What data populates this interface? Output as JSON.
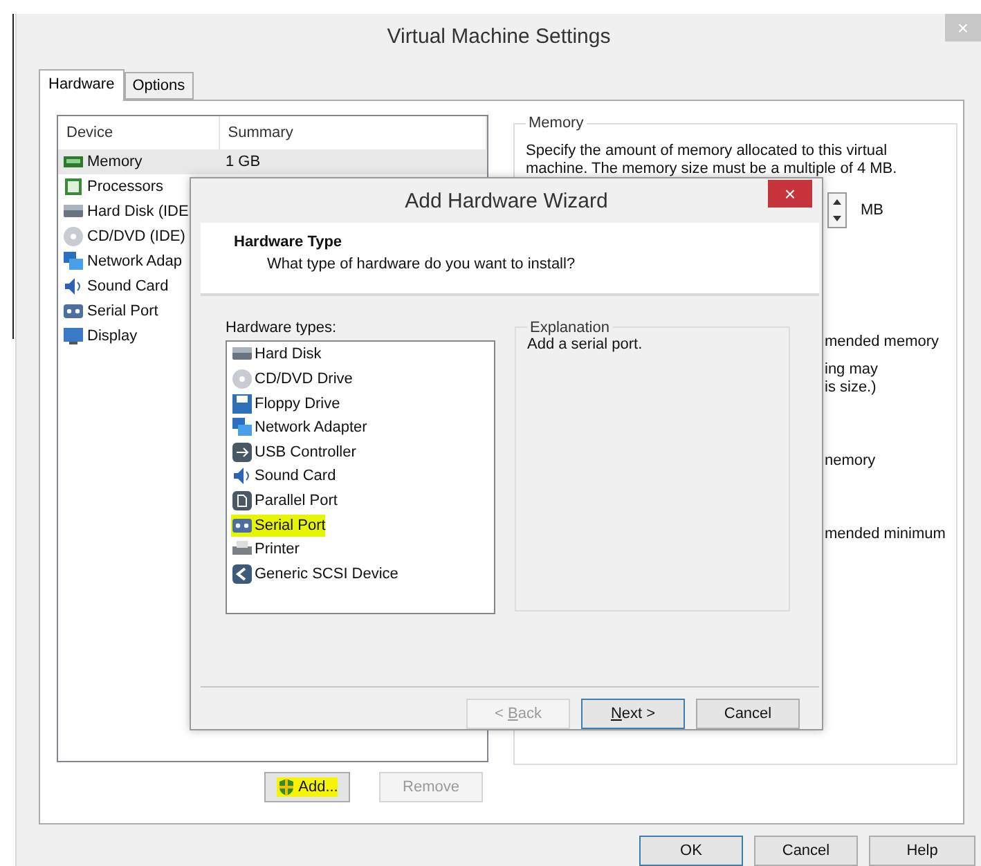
{
  "window": {
    "title": "Virtual Machine Settings",
    "close": "×"
  },
  "tabs": [
    {
      "label": "Hardware",
      "selected": true
    },
    {
      "label": "Options",
      "selected": false
    }
  ],
  "device_table": {
    "columns": [
      "Device",
      "Summary"
    ],
    "rows": [
      {
        "kind": "memory",
        "device": "Memory",
        "summary": "1 GB",
        "selected": true
      },
      {
        "kind": "processor",
        "device": "Processors",
        "selected": false
      },
      {
        "kind": "disk",
        "device": "Hard Disk (IDE",
        "selected": false
      },
      {
        "kind": "cd",
        "device": "CD/DVD (IDE)",
        "selected": false
      },
      {
        "kind": "network",
        "device": "Network Adap",
        "selected": false
      },
      {
        "kind": "sound",
        "device": "Sound Card",
        "selected": false
      },
      {
        "kind": "serial",
        "device": "Serial Port",
        "selected": false
      },
      {
        "kind": "display",
        "device": "Display",
        "selected": false
      }
    ]
  },
  "device_buttons": [
    {
      "label": "Add...",
      "disabled": false,
      "highlighted": true
    },
    {
      "label": "Remove",
      "disabled": true,
      "highlighted": false
    }
  ],
  "memory": {
    "legend": "Memory",
    "description": "Specify the amount of memory allocated to this virtual machine. The memory size must be a multiple of 4 MB.",
    "unit": "MB",
    "fragments": [
      "mended memory",
      "ing may",
      "is size.)",
      "nemory",
      "mended minimum"
    ]
  },
  "wizard": {
    "title": "Add Hardware Wizard",
    "close": "×",
    "heading": "Hardware Type",
    "subheading": "What type of hardware do you want to install?",
    "list_label": "Hardware types:",
    "hardware_types": [
      {
        "kind": "disk",
        "label": "Hard Disk",
        "selected": false
      },
      {
        "kind": "cd",
        "label": "CD/DVD Drive",
        "selected": false
      },
      {
        "kind": "floppy",
        "label": "Floppy Drive",
        "selected": false
      },
      {
        "kind": "network",
        "label": "Network Adapter",
        "selected": false
      },
      {
        "kind": "usb",
        "label": "USB Controller",
        "selected": false
      },
      {
        "kind": "sound",
        "label": "Sound Card",
        "selected": false
      },
      {
        "kind": "parallel",
        "label": "Parallel Port",
        "selected": false
      },
      {
        "kind": "serial",
        "label": "Serial Port",
        "selected": true
      },
      {
        "kind": "printer",
        "label": "Printer",
        "selected": false
      },
      {
        "kind": "scsi",
        "label": "Generic SCSI Device",
        "selected": false
      }
    ],
    "explanation": {
      "legend": "Explanation",
      "text": "Add a serial port."
    },
    "buttons": [
      {
        "before": "< ",
        "key": "B",
        "after": "ack",
        "disabled": true,
        "default": false
      },
      {
        "key": "N",
        "after": "ext >",
        "disabled": false,
        "default": true
      },
      {
        "before": "Cancel",
        "disabled": false,
        "default": false
      }
    ]
  },
  "dialog_buttons": [
    {
      "label": "OK",
      "default": true
    },
    {
      "label": "Cancel",
      "default": false
    },
    {
      "label": "Help",
      "default": false
    }
  ]
}
